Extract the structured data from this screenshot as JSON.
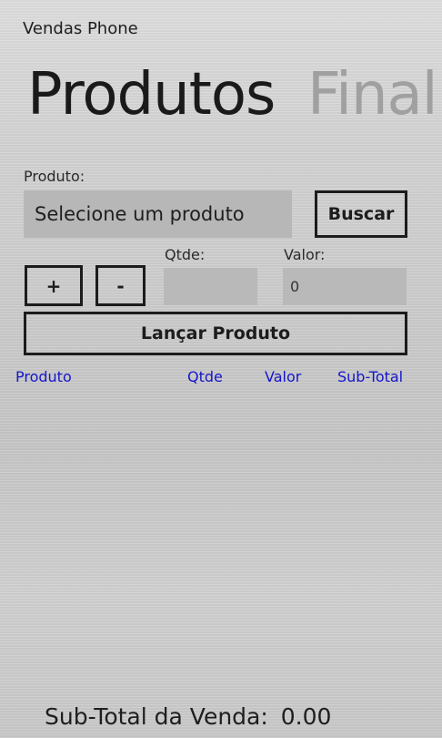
{
  "app": {
    "title": "Vendas Phone"
  },
  "pivot": {
    "current": "Produtos",
    "next": "Final"
  },
  "form": {
    "produto_label": "Produto:",
    "produto_select": "Selecione um produto",
    "buscar_button": "Buscar",
    "plus_button": "+",
    "minus_button": "-",
    "qtde_label": "Qtde:",
    "qtde_value": "",
    "valor_label": "Valor:",
    "valor_value": "0",
    "lancar_button": "Lançar Produto"
  },
  "table": {
    "columns": [
      "Produto",
      "Qtde",
      "Valor",
      "Sub-Total"
    ],
    "rows": []
  },
  "footer": {
    "subtotal_label": "Sub-Total da Venda:",
    "subtotal_value": "0.00"
  },
  "colors": {
    "accent_link": "#1515cc",
    "input_fill": "#b9b9b9",
    "text": "#1a1a1a"
  }
}
